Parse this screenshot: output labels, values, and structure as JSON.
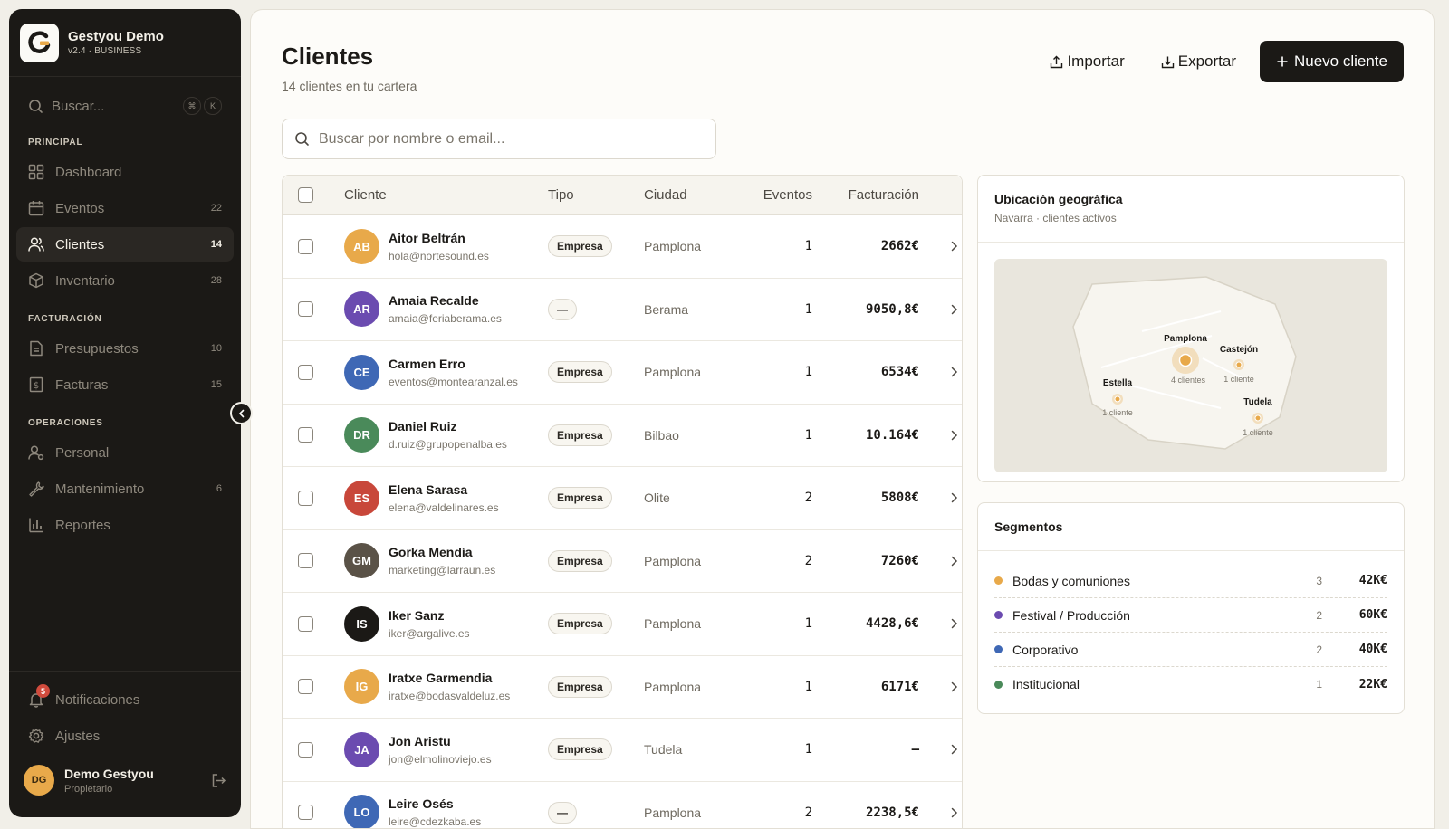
{
  "app": {
    "name": "Gestyou Demo",
    "version": "v2.4 · BUSINESS"
  },
  "sidebar": {
    "search_placeholder": "Buscar...",
    "kbd": [
      "⌘",
      "K"
    ],
    "sections": [
      {
        "title": "PRINCIPAL",
        "items": [
          {
            "label": "Dashboard",
            "count": "",
            "icon": "dashboard-icon"
          },
          {
            "label": "Eventos",
            "count": "22",
            "icon": "calendar-icon"
          },
          {
            "label": "Clientes",
            "count": "14",
            "icon": "users-icon",
            "active": true
          },
          {
            "label": "Inventario",
            "count": "28",
            "icon": "box-icon"
          }
        ]
      },
      {
        "title": "FACTURACIÓN",
        "items": [
          {
            "label": "Presupuestos",
            "count": "10",
            "icon": "document-icon"
          },
          {
            "label": "Facturas",
            "count": "15",
            "icon": "invoice-icon"
          }
        ]
      },
      {
        "title": "OPERACIONES",
        "items": [
          {
            "label": "Personal",
            "count": "",
            "icon": "person-icon"
          },
          {
            "label": "Mantenimiento",
            "count": "6",
            "icon": "wrench-icon"
          },
          {
            "label": "Reportes",
            "count": "",
            "icon": "chart-icon"
          }
        ]
      }
    ],
    "notifications": {
      "label": "Notificaciones",
      "badge": "5"
    },
    "settings": {
      "label": "Ajustes"
    },
    "user": {
      "initials": "DG",
      "name": "Demo Gestyou",
      "role": "Propietario"
    }
  },
  "header": {
    "title": "Clientes",
    "subtitle": "14 clientes en tu cartera",
    "import_label": "Importar",
    "export_label": "Exportar",
    "new_label": "Nuevo cliente"
  },
  "search": {
    "placeholder": "Buscar por nombre o email..."
  },
  "table": {
    "columns": [
      "Cliente",
      "Tipo",
      "Ciudad",
      "Eventos",
      "Facturación"
    ],
    "rows": [
      {
        "initials": "AB",
        "color": "#e8a94a",
        "name": "Aitor Beltrán",
        "email": "hola@nortesound.es",
        "tipo": "Empresa",
        "ciudad": "Pamplona",
        "eventos": "1",
        "facturacion": "2662€"
      },
      {
        "initials": "AR",
        "color": "#6b4bb0",
        "name": "Amaia Recalde",
        "email": "amaia@feriaberama.es",
        "tipo": "—",
        "ciudad": "Berama",
        "eventos": "1",
        "facturacion": "9050,8€"
      },
      {
        "initials": "CE",
        "color": "#3f68b5",
        "name": "Carmen Erro",
        "email": "eventos@montearanzal.es",
        "tipo": "Empresa",
        "ciudad": "Pamplona",
        "eventos": "1",
        "facturacion": "6534€"
      },
      {
        "initials": "DR",
        "color": "#4a8a5a",
        "name": "Daniel Ruiz",
        "email": "d.ruiz@grupopenalba.es",
        "tipo": "Empresa",
        "ciudad": "Bilbao",
        "eventos": "1",
        "facturacion": "10.164€"
      },
      {
        "initials": "ES",
        "color": "#c8473a",
        "name": "Elena Sarasa",
        "email": "elena@valdelinares.es",
        "tipo": "Empresa",
        "ciudad": "Olite",
        "eventos": "2",
        "facturacion": "5808€"
      },
      {
        "initials": "GM",
        "color": "#5a5247",
        "name": "Gorka Mendía",
        "email": "marketing@larraun.es",
        "tipo": "Empresa",
        "ciudad": "Pamplona",
        "eventos": "2",
        "facturacion": "7260€"
      },
      {
        "initials": "IS",
        "color": "#1b1916",
        "name": "Iker Sanz",
        "email": "iker@argalive.es",
        "tipo": "Empresa",
        "ciudad": "Pamplona",
        "eventos": "1",
        "facturacion": "4428,6€"
      },
      {
        "initials": "IG",
        "color": "#e8a94a",
        "name": "Iratxe Garmendia",
        "email": "iratxe@bodasvaldeluz.es",
        "tipo": "Empresa",
        "ciudad": "Pamplona",
        "eventos": "1",
        "facturacion": "6171€"
      },
      {
        "initials": "JA",
        "color": "#6b4bb0",
        "name": "Jon Aristu",
        "email": "jon@elmolinoviejo.es",
        "tipo": "Empresa",
        "ciudad": "Tudela",
        "eventos": "1",
        "facturacion": "—"
      },
      {
        "initials": "LO",
        "color": "#3f68b5",
        "name": "Leire Osés",
        "email": "leire@cdezkaba.es",
        "tipo": "—",
        "ciudad": "Pamplona",
        "eventos": "2",
        "facturacion": "2238,5€"
      }
    ]
  },
  "geo": {
    "title": "Ubicación geográfica",
    "subtitle": "Navarra · clientes activos",
    "places": [
      {
        "name": "Pamplona",
        "count": "4 clientes"
      },
      {
        "name": "Castejón",
        "count": "1 cliente"
      },
      {
        "name": "Estella",
        "count": "1 cliente"
      },
      {
        "name": "Tudela",
        "count": "1 cliente"
      }
    ]
  },
  "segments": {
    "title": "Segmentos",
    "items": [
      {
        "label": "Bodas y comuniones",
        "count": "3",
        "amount": "42K€",
        "color": "#e8a94a"
      },
      {
        "label": "Festival / Producción",
        "count": "2",
        "amount": "60K€",
        "color": "#6b4bb0"
      },
      {
        "label": "Corporativo",
        "count": "2",
        "amount": "40K€",
        "color": "#3f68b5"
      },
      {
        "label": "Institucional",
        "count": "1",
        "amount": "22K€",
        "color": "#4a8a5a"
      }
    ]
  }
}
